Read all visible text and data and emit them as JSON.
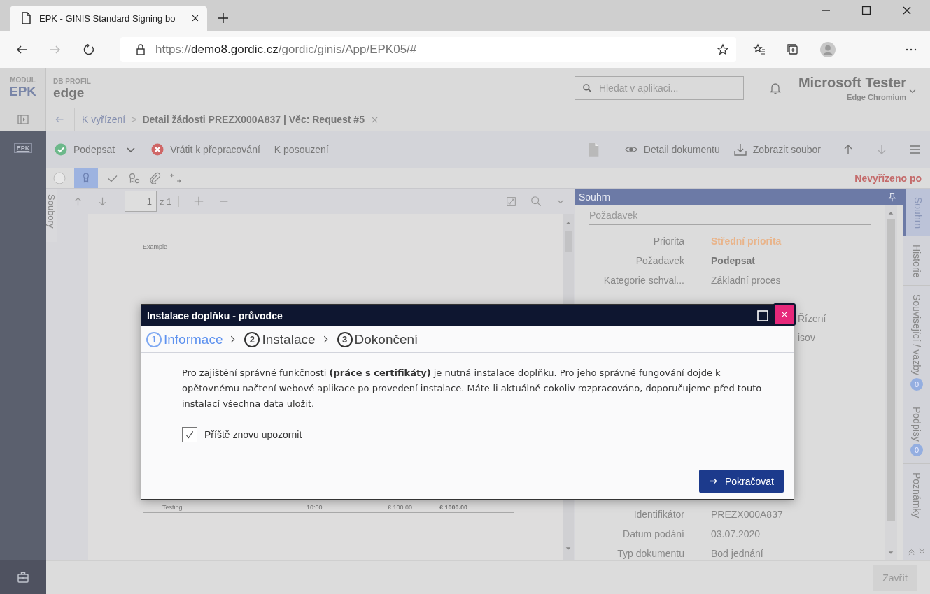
{
  "browser": {
    "tab_title": "EPK - GINIS Standard Signing bo",
    "url": {
      "scheme": "https://",
      "host": "demo8.gordic.cz",
      "path": "/gordic/ginis/App/EPK05/#"
    }
  },
  "header": {
    "module_label": "MODUL",
    "module": "EPK",
    "profile_label": "DB PROFIL",
    "profile": "edge",
    "search_placeholder": "Hledat v aplikaci...",
    "user_name": "Microsoft Tester",
    "user_sub": "Edge Chromium"
  },
  "breadcrumb": {
    "link": "K vyřízení",
    "separator": ">",
    "current": "Detail žádosti PREZX000A837 | Věc: Request #5"
  },
  "sidebar": {
    "logo": "EPK"
  },
  "toolbar": {
    "left": [
      {
        "kind": "sign",
        "label": "Podepsat"
      },
      {
        "kind": "caret"
      },
      {
        "kind": "reject",
        "label": "Vrátit k přepracování"
      },
      {
        "kind": "plain",
        "label": "K posouzení"
      }
    ],
    "right": [
      {
        "kind": "document",
        "disabled": false
      },
      {
        "kind": "eye",
        "label": "Detail dokumentu",
        "disabled": false
      },
      {
        "kind": "download",
        "label": "Zobrazit soubor",
        "disabled": false
      },
      {
        "kind": "up",
        "disabled": false
      },
      {
        "kind": "down",
        "disabled": true
      },
      {
        "kind": "lines",
        "disabled": false
      }
    ]
  },
  "filters": [
    {
      "kind": "circle",
      "selected": false
    },
    {
      "kind": "ribbon",
      "selected": true
    },
    {
      "kind": "check",
      "selected": false
    },
    {
      "kind": "ribbon-circle",
      "selected": false
    },
    {
      "kind": "clip",
      "selected": false
    },
    {
      "kind": "arrows",
      "selected": false
    }
  ],
  "status": "Nevyřízeno po",
  "viewer": {
    "side_tab": "Soubory",
    "page": "1",
    "page_total": "z 1",
    "doc_caption": "Example",
    "table_row": [
      "Testing",
      "10:00",
      "€ 100.00",
      "€ 1000.00"
    ]
  },
  "summary": {
    "title": "Souhrn",
    "section": "Požadavek",
    "rows": [
      {
        "kind": "priority",
        "label": "Priorita",
        "value": "Střední priorita"
      },
      {
        "kind": "bold",
        "label": "Požadavek",
        "value": "Podepsat"
      },
      {
        "kind": "plain",
        "label": "Kategorie schval...",
        "value": "Základní proces"
      },
      {
        "kind": "tail",
        "value": "Řízení"
      },
      {
        "kind": "tail",
        "value": "isov"
      }
    ],
    "lower_rows": [
      {
        "label": "Identifikátor",
        "value": "PREZX000A837"
      },
      {
        "label": "Datum podání",
        "value": "03.07.2020"
      },
      {
        "label": "Typ dokumentu",
        "value": "Bod jednání"
      }
    ]
  },
  "side_tabs": [
    {
      "label": "Souhrn",
      "selected": true
    },
    {
      "label": "Historie",
      "selected": false
    },
    {
      "label": "Související / vazby",
      "badge": "0",
      "selected": false
    },
    {
      "label": "Podpisy",
      "badge": "0",
      "selected": false
    },
    {
      "label": "Poznámky",
      "selected": false
    }
  ],
  "footer": {
    "close": "Zavřít"
  },
  "dialog": {
    "title": "Instalace doplňku - průvodce",
    "steps": [
      {
        "number": "1",
        "label": "Informace",
        "selected": true
      },
      {
        "number": "2",
        "label": "Instalace",
        "selected": false
      },
      {
        "number": "3",
        "label": "Dokončení",
        "selected": false
      }
    ],
    "message": "Pro zajištění správné funkčnosti **(práce s certifikáty)** je nutná instalace doplňku. Pro jeho správné fungování dojde k opětovnému načtení webové aplikace po provedení instalace. Máte-li aktuálně cokoliv rozpracováno, doporučujeme před touto instalací všechna data uložit.",
    "checkbox": {
      "label": "Příště znovu upozornit",
      "checked": true
    },
    "button": "Pokračovat"
  }
}
